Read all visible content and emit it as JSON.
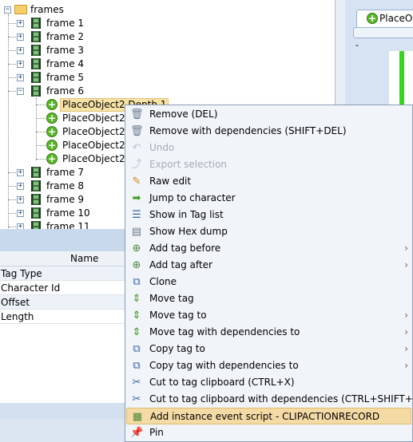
{
  "tree": {
    "root_label": "frames",
    "frames": [
      "frame 1",
      "frame 2",
      "frame 3",
      "frame 4",
      "frame 5",
      "frame 6"
    ],
    "children": [
      "PlaceObject2 Depth 1",
      "PlaceObject2 I",
      "PlaceObject2 I",
      "PlaceObject2 I",
      "PlaceObject2 I"
    ],
    "frames_after": [
      "frame 7",
      "frame 8",
      "frame 9",
      "frame 10",
      "frame 11"
    ]
  },
  "preview": {
    "tab_label": "PlaceOb",
    "dash": "-"
  },
  "properties": {
    "column_header": "Name",
    "rows": [
      "Tag Type",
      "Character Id",
      "Offset",
      "Length"
    ]
  },
  "context_menu": {
    "items": [
      {
        "label": "Remove (DEL)",
        "icon": "remove-icon",
        "enabled": true,
        "submenu": false
      },
      {
        "label": "Remove with dependencies (SHIFT+DEL)",
        "icon": "remove-deps-icon",
        "enabled": true,
        "submenu": false
      },
      {
        "label": "Undo",
        "icon": "undo-icon",
        "enabled": false,
        "submenu": false
      },
      {
        "label": "Export selection",
        "icon": "export-icon",
        "enabled": false,
        "submenu": false
      },
      {
        "label": "Raw edit",
        "icon": "pencil-icon",
        "enabled": true,
        "submenu": false
      },
      {
        "label": "Jump to character",
        "icon": "arrow-right-icon",
        "enabled": true,
        "submenu": false
      },
      {
        "label": "Show in Tag list",
        "icon": "list-icon",
        "enabled": true,
        "submenu": false
      },
      {
        "label": "Show Hex dump",
        "icon": "document-icon",
        "enabled": true,
        "submenu": false
      },
      {
        "label": "Add tag before",
        "icon": "add-tag-icon",
        "enabled": true,
        "submenu": true
      },
      {
        "label": "Add tag after",
        "icon": "add-tag-icon",
        "enabled": true,
        "submenu": true
      },
      {
        "label": "Clone",
        "icon": "clone-icon",
        "enabled": true,
        "submenu": false
      },
      {
        "label": "Move tag",
        "icon": "move-icon",
        "enabled": true,
        "submenu": false
      },
      {
        "label": "Move tag to",
        "icon": "move-icon",
        "enabled": true,
        "submenu": true
      },
      {
        "label": "Move tag with dependencies to",
        "icon": "move-icon",
        "enabled": true,
        "submenu": true
      },
      {
        "label": "Copy tag to",
        "icon": "copy-icon",
        "enabled": true,
        "submenu": true
      },
      {
        "label": "Copy tag with dependencies to",
        "icon": "copy-icon",
        "enabled": true,
        "submenu": true
      },
      {
        "label": "Cut to tag clipboard (CTRL+X)",
        "icon": "scissors-icon",
        "enabled": true,
        "submenu": false
      },
      {
        "label": "Cut to tag clipboard with dependencies (CTRL+SHIFT+X)",
        "icon": "scissors-icon",
        "enabled": true,
        "submenu": false
      },
      {
        "label": "Add instance event script - CLIPACTIONRECORD",
        "icon": "script-icon",
        "enabled": true,
        "submenu": false,
        "hovered": true
      },
      {
        "label": "Pin",
        "icon": "pin-icon",
        "enabled": true,
        "submenu": false
      }
    ]
  },
  "colors": {
    "selection_bg": "#f7e2a6",
    "menu_hover_bg": "#f4dba6",
    "accent_green": "#58b62a",
    "preview_green": "#35d71a"
  }
}
